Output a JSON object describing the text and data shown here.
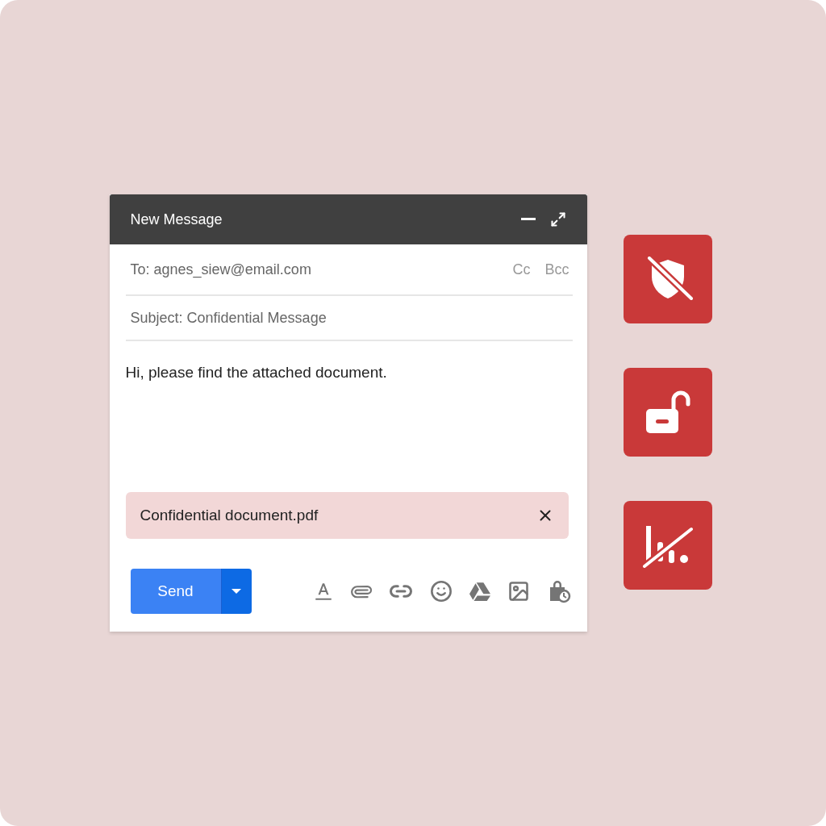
{
  "window": {
    "title": "New Message"
  },
  "to_field": {
    "label": "To:",
    "value": "agnes_siew@email.com"
  },
  "recipient_links": [
    "Cc",
    "Bcc"
  ],
  "subject_field": {
    "label": "Subject:",
    "value": "Confidential Message"
  },
  "body": "Hi, please find the attached document.",
  "attachment": {
    "name": "Confidential document.pdf"
  },
  "send_button": {
    "label": "Send"
  }
}
